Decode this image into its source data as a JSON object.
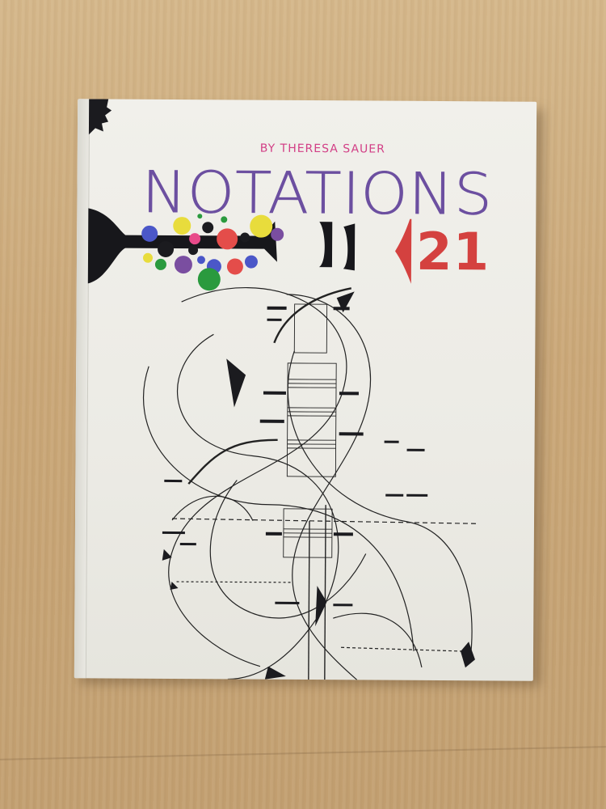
{
  "cover": {
    "author": "BY THERESA SAUER",
    "title": "NOTATIONS",
    "volume": "21"
  },
  "colors": {
    "author": "#d23f86",
    "title": "#6c4fa0",
    "volume": "#d4413f",
    "cover": "#eeede7",
    "table": "#caa777"
  }
}
